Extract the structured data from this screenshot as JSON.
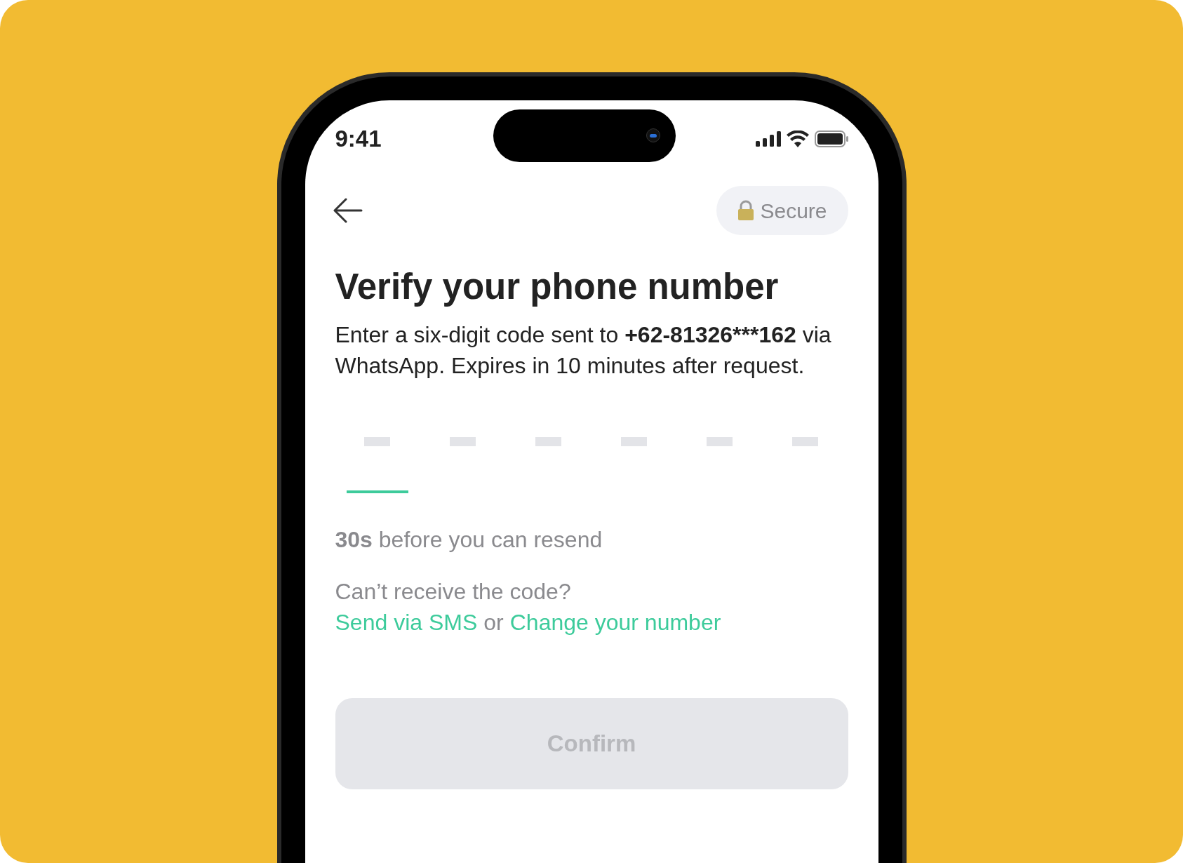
{
  "status_bar": {
    "time": "9:41"
  },
  "header": {
    "badge": "Secure"
  },
  "title": "Verify your phone number",
  "description": {
    "before": "Enter a six-digit code sent to ",
    "phone": "+62-81326***162",
    "after": " via WhatsApp. Expires in 10 minutes after request."
  },
  "code_slots": [
    {
      "selected": true
    },
    {
      "selected": false
    },
    {
      "selected": false
    },
    {
      "selected": false
    },
    {
      "selected": false
    },
    {
      "selected": false
    }
  ],
  "resend": "**30s** before you can resend",
  "help": {
    "question": "Can’t receive the code?",
    "sms_link": "Send via SMS",
    "separator": "or",
    "change_link": "Change your number"
  },
  "confirm": {
    "label": "Confirm",
    "disabled": true
  }
}
